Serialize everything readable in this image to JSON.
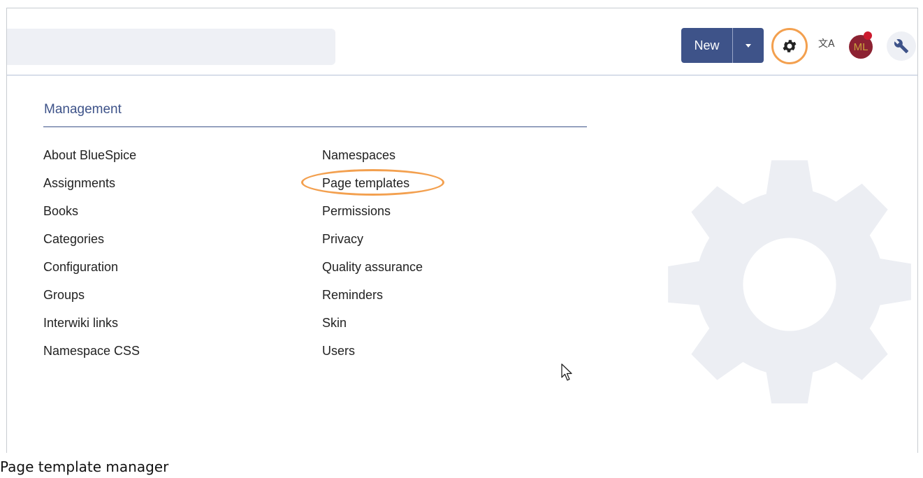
{
  "header": {
    "new_label": "New",
    "translate_glyph": "文A",
    "avatar_initials": "ML"
  },
  "menu": {
    "section_title": "Management",
    "col1": [
      "About BlueSpice",
      "Assignments",
      "Books",
      "Categories",
      "Configuration",
      "Groups",
      "Interwiki links",
      "Namespace CSS"
    ],
    "col2": [
      "Namespaces",
      "Page templates",
      "Permissions",
      "Privacy",
      "Quality assurance",
      "Reminders",
      "Skin",
      "Users"
    ],
    "highlighted_item": "Page templates"
  },
  "caption": "Page template manager",
  "icons": {
    "gear": "gear-icon",
    "translate": "translate-icon",
    "wrench": "wrench-icon",
    "caret": "caret-down-icon",
    "background": "gear-watermark-icon",
    "cursor": "mouse-cursor-icon"
  },
  "colors": {
    "primary": "#3e5389",
    "highlight": "#f3a04f",
    "avatar_bg": "#8c2232",
    "notification": "#cc1a2e",
    "watermark": "#eceef3"
  }
}
